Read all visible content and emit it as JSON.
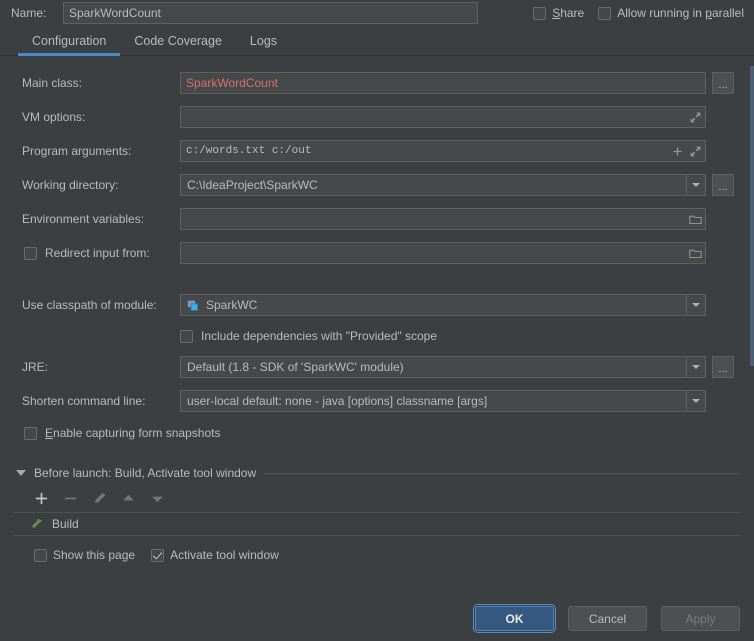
{
  "header": {
    "name_label": "Name:",
    "name_value": "SparkWordCount",
    "share_label": "Share",
    "share_checked": false,
    "parallel_label": "Allow running in parallel",
    "parallel_checked": false
  },
  "tabs": [
    {
      "label": "Configuration",
      "active": true
    },
    {
      "label": "Code Coverage",
      "active": false
    },
    {
      "label": "Logs",
      "active": false
    }
  ],
  "form": {
    "main_class": {
      "label": "Main class:",
      "value": "SparkWordCount",
      "error": true,
      "browse_label": "..."
    },
    "vm_options": {
      "label": "VM options:",
      "value": "",
      "expand_icon": "expand-icon"
    },
    "program_arguments": {
      "label": "Program arguments:",
      "value": "c:/words.txt c:/out",
      "add_icon": "plus-icon",
      "expand_icon": "expand-icon"
    },
    "working_directory": {
      "label": "Working directory:",
      "value": "C:\\IdeaProject\\SparkWC",
      "browse_label": "..."
    },
    "environment_variables": {
      "label": "Environment variables:",
      "value": "",
      "browse_icon": "folder-icon"
    },
    "redirect_input": {
      "label": "Redirect input from:",
      "checked": false,
      "value": "",
      "browse_icon": "folder-icon"
    },
    "classpath_module": {
      "label": "Use classpath of module:",
      "value": "SparkWC",
      "module_icon": "module-icon"
    },
    "include_provided": {
      "label": "Include dependencies with \"Provided\" scope",
      "checked": false
    },
    "jre": {
      "label": "JRE:",
      "value": "Default (1.8 - SDK of 'SparkWC' module)",
      "browse_label": "..."
    },
    "shorten_command_line": {
      "label": "Shorten command line:",
      "value": "user-local default: none - java [options] classname [args]"
    },
    "form_snapshots": {
      "label": "Enable capturing form snapshots",
      "checked": false
    }
  },
  "before_launch": {
    "title": "Before launch: Build, Activate tool window",
    "toolbar": [
      {
        "name": "add-icon",
        "enabled": true
      },
      {
        "name": "remove-icon",
        "enabled": false
      },
      {
        "name": "edit-icon",
        "enabled": false
      },
      {
        "name": "move-up-icon",
        "enabled": false
      },
      {
        "name": "move-down-icon",
        "enabled": false
      }
    ],
    "items": [
      {
        "label": "Build",
        "icon": "build-hammer-icon"
      }
    ],
    "show_page": {
      "label": "Show this page",
      "checked": false
    },
    "activate_tool_window": {
      "label": "Activate tool window",
      "checked": true
    }
  },
  "buttons": {
    "ok": "OK",
    "cancel": "Cancel",
    "apply": "Apply"
  },
  "colors": {
    "background": "#3c3f41",
    "field_background": "#45494a",
    "accent_blue": "#4a88c7",
    "primary_button": "#365880",
    "error_text": "#d9706b",
    "build_icon_green": "#6fa94a",
    "text": "#bbbbbb"
  }
}
